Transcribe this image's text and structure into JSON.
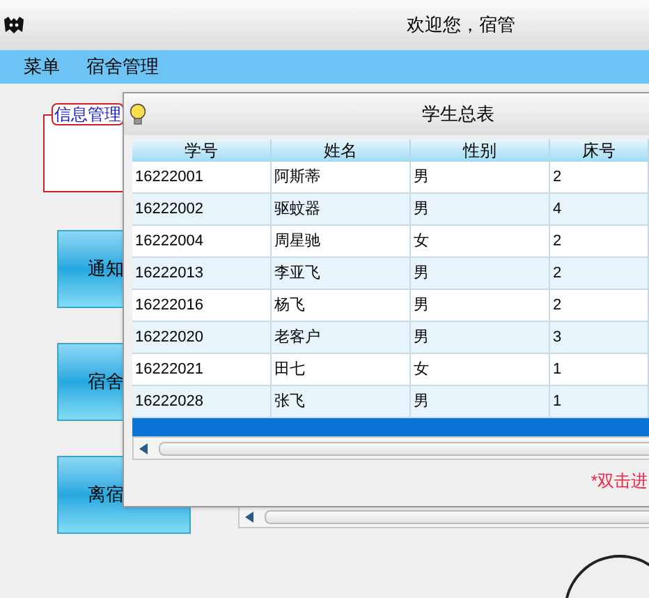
{
  "window": {
    "title": "欢迎您，宿管"
  },
  "menu": [
    {
      "label": "菜单"
    },
    {
      "label": "宿舍管理"
    }
  ],
  "info_group": {
    "legend": "信息管理"
  },
  "side_buttons": [
    {
      "label": "通知"
    },
    {
      "label": "宿舍"
    },
    {
      "label": "离宿"
    }
  ],
  "dialog": {
    "title": "学生总表",
    "hint": "*双击进",
    "table": {
      "columns": [
        "学号",
        "姓名",
        "性别",
        "床号"
      ],
      "rows": [
        {
          "cells": [
            "16222001",
            "阿斯蒂",
            "男",
            "2"
          ],
          "selected": false
        },
        {
          "cells": [
            "16222002",
            "驱蚊器",
            "男",
            "4"
          ],
          "selected": false
        },
        {
          "cells": [
            "16222004",
            "周星驰",
            "女",
            "2"
          ],
          "selected": false
        },
        {
          "cells": [
            "16222013",
            "李亚飞",
            "男",
            "2"
          ],
          "selected": false
        },
        {
          "cells": [
            "16222016",
            "杨飞",
            "男",
            "2"
          ],
          "selected": false
        },
        {
          "cells": [
            "16222020",
            "老客户",
            "男",
            "3"
          ],
          "selected": false
        },
        {
          "cells": [
            "16222021",
            "田七",
            "女",
            "1"
          ],
          "selected": false
        },
        {
          "cells": [
            "16222028",
            "张飞",
            "男",
            "1"
          ],
          "selected": false
        },
        {
          "selected": true
        }
      ]
    }
  }
}
